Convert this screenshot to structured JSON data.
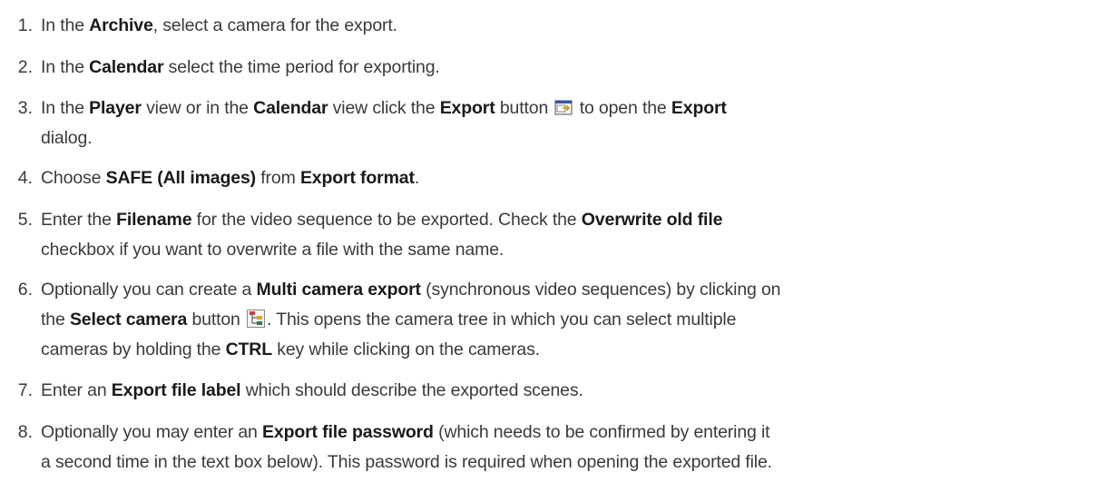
{
  "steps": [
    {
      "number": "1.",
      "parts": [
        {
          "t": "In the "
        },
        {
          "t": "Archive",
          "b": true
        },
        {
          "t": ", select a camera for the export."
        }
      ]
    },
    {
      "number": "2.",
      "parts": [
        {
          "t": "In the "
        },
        {
          "t": "Calendar",
          "b": true
        },
        {
          "t": " select the time period for exporting."
        }
      ]
    },
    {
      "number": "3.",
      "parts": [
        {
          "t": "In the "
        },
        {
          "t": "Player",
          "b": true
        },
        {
          "t": " view or in the "
        },
        {
          "t": "Calendar",
          "b": true
        },
        {
          "t": " view click the "
        },
        {
          "t": "Export",
          "b": true
        },
        {
          "t": " button "
        },
        {
          "icon": "export-icon"
        },
        {
          "t": " to open the "
        },
        {
          "t": "Export",
          "b": true
        },
        {
          "br": true
        },
        {
          "t": "dialog."
        }
      ]
    },
    {
      "number": "4.",
      "parts": [
        {
          "t": "Choose "
        },
        {
          "t": "SAFE (All images)",
          "b": true
        },
        {
          "t": " from "
        },
        {
          "t": "Export format",
          "b": true
        },
        {
          "t": "."
        }
      ]
    },
    {
      "number": "5.",
      "parts": [
        {
          "t": "Enter the "
        },
        {
          "t": "Filename",
          "b": true
        },
        {
          "t": " for the video sequence to be exported. Check the "
        },
        {
          "t": "Overwrite old file",
          "b": true
        },
        {
          "br": true
        },
        {
          "t": "checkbox if you want to overwrite a file with the same name."
        }
      ]
    },
    {
      "number": "6.",
      "parts": [
        {
          "t": "Optionally you can create a "
        },
        {
          "t": "Multi camera export",
          "b": true
        },
        {
          "t": " (synchronous video sequences) by clicking on"
        },
        {
          "br": true
        },
        {
          "t": "the "
        },
        {
          "t": "Select camera",
          "b": true
        },
        {
          "t": " button "
        },
        {
          "icon": "camera-tree-icon"
        },
        {
          "t": ". This opens the camera tree in which you can select multiple"
        },
        {
          "br": true
        },
        {
          "t": "cameras by holding the "
        },
        {
          "t": "CTRL",
          "b": true
        },
        {
          "t": " key while clicking on the cameras."
        }
      ]
    },
    {
      "number": "7.",
      "parts": [
        {
          "t": "Enter an "
        },
        {
          "t": "Export file label",
          "b": true
        },
        {
          "t": " which should describe the exported scenes."
        }
      ]
    },
    {
      "number": "8.",
      "parts": [
        {
          "t": "Optionally you may enter an "
        },
        {
          "t": "Export file password",
          "b": true
        },
        {
          "t": " (which needs to be confirmed by entering it"
        },
        {
          "br": true
        },
        {
          "t": "a second time in the text box below). This password is required when opening the exported file."
        }
      ]
    }
  ]
}
